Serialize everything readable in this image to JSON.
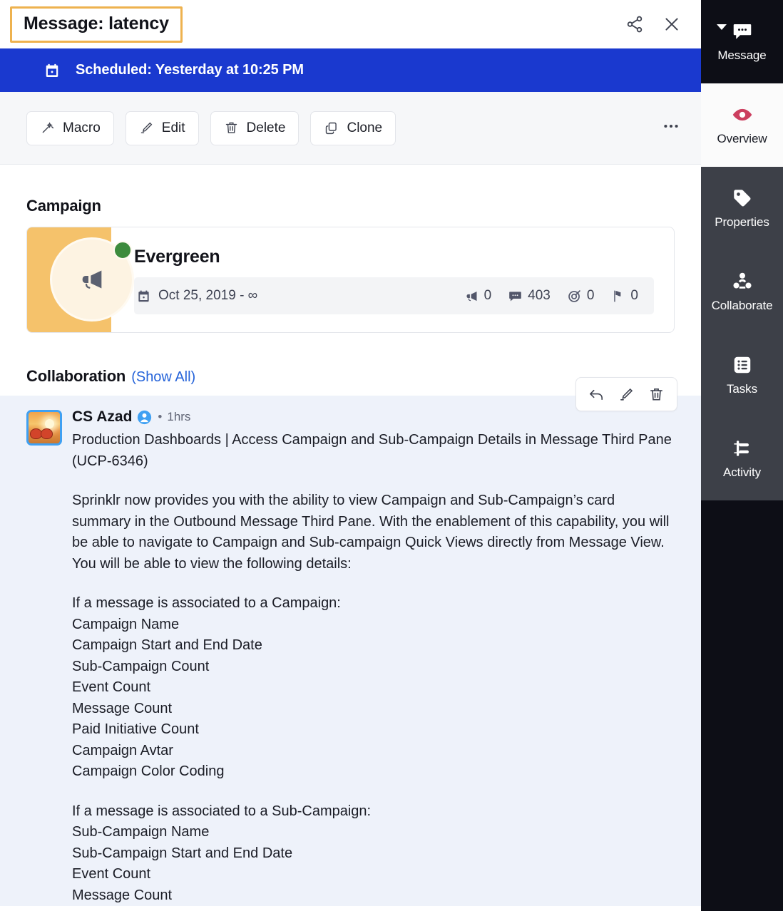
{
  "header": {
    "title": "Message: latency",
    "highlight_color": "#eeb24f",
    "share_icon": "share-icon",
    "close_icon": "close-icon"
  },
  "scheduled_banner": {
    "icon": "calendar-icon",
    "text": "Scheduled: Yesterday at 10:25 PM",
    "background": "#1a39cf"
  },
  "toolbar": {
    "buttons": [
      {
        "label": "Macro",
        "icon": "magic-wand-icon"
      },
      {
        "label": "Edit",
        "icon": "pencil-icon"
      },
      {
        "label": "Delete",
        "icon": "trash-icon"
      },
      {
        "label": "Clone",
        "icon": "clone-icon"
      }
    ],
    "overflow_icon": "ellipsis-icon"
  },
  "campaign": {
    "section_label": "Campaign",
    "name": "Evergreen",
    "date_range": "Oct 25, 2019 - ∞",
    "date_icon": "calendar-icon",
    "avatar_icon": "megaphone-icon",
    "status_color": "#3d8b3d",
    "band_color": "#f5c26b",
    "stats": [
      {
        "icon": "megaphone-icon",
        "value": "0"
      },
      {
        "icon": "message-icon",
        "value": "403"
      },
      {
        "icon": "target-icon",
        "value": "0"
      },
      {
        "icon": "flag-icon",
        "value": "0"
      }
    ]
  },
  "collaboration": {
    "section_label": "Collaboration",
    "show_all_label": "(Show All)",
    "note_actions": [
      {
        "icon": "reply-icon"
      },
      {
        "icon": "pencil-icon"
      },
      {
        "icon": "trash-icon"
      }
    ],
    "note": {
      "author": "CS Azad",
      "author_badge_icon": "user-badge-icon",
      "separator": "•",
      "timestamp": "1hrs",
      "avatar_icon": "sunset-photo-avatar",
      "subject": "Production Dashboards | Access Campaign and Sub-Campaign Details in Message Third Pane (UCP-6346)",
      "body": "Sprinklr now provides you with the ability to view Campaign and Sub-Campaign’s card summary in the Outbound Message Third Pane. With the enablement of this capability, you will be able to navigate to Campaign and Sub-campaign Quick Views directly from Message View. You will be able to view the following details:",
      "campaign_intro": "If a message is associated to a Campaign:",
      "campaign_items": [
        "Campaign Name",
        "Campaign Start and End Date",
        "Sub-Campaign Count",
        "Event Count",
        "Message Count",
        "Paid Initiative Count",
        "Campaign Avtar",
        "Campaign Color Coding"
      ],
      "subcampaign_intro": "If a message is associated to a Sub-Campaign:",
      "subcampaign_items": [
        "Sub-Campaign Name",
        "Sub-Campaign Start and End Date",
        "Event Count",
        "Message Count"
      ]
    }
  },
  "sidebar": {
    "items": [
      {
        "label": "Message",
        "icon": "message-bubble-icon",
        "state": "dark",
        "caret": true
      },
      {
        "label": "Overview",
        "icon": "eye-icon",
        "state": "active",
        "caret": false
      },
      {
        "label": "Properties",
        "icon": "tag-icon",
        "state": "grey",
        "caret": false
      },
      {
        "label": "Collaborate",
        "icon": "people-icon",
        "state": "grey",
        "caret": false
      },
      {
        "label": "Tasks",
        "icon": "list-icon",
        "state": "grey",
        "caret": false
      },
      {
        "label": "Activity",
        "icon": "activity-icon",
        "state": "grey",
        "caret": false
      }
    ],
    "accent_color": "#cc3f5f"
  }
}
